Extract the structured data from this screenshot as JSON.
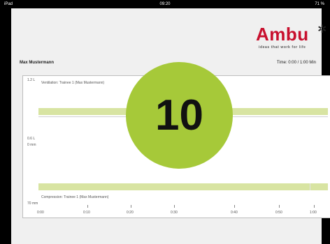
{
  "status_bar": {
    "carrier": "iPad",
    "clock": "09:20",
    "battery": "71 %"
  },
  "logo": {
    "brand": "Ambu",
    "tagline": "ideas that work for life"
  },
  "header": {
    "trainee_name": "Max Mustermann",
    "time": "Time: 0:00 / 1:00 Min"
  },
  "chart": {
    "ventilation_label": "Ventilation: Trainee 1 (Max Mustermann)",
    "compression_label": "Compression: Trainee 1 (Max Mustermann)",
    "y_labels": {
      "top": "1.2 L",
      "mid_volume": "0.6 L",
      "mid_depth": "0 mm",
      "bottom": "70 mm"
    },
    "x_ticks": [
      "0:00",
      "0:10",
      "0:20",
      "0:30",
      "0:40",
      "0:50",
      "1:00"
    ]
  },
  "countdown": {
    "value": "10",
    "color": "#a6c939"
  },
  "colors": {
    "accent": "#a6c939",
    "band": "#d8e4a2",
    "brand": "#c8102e"
  }
}
